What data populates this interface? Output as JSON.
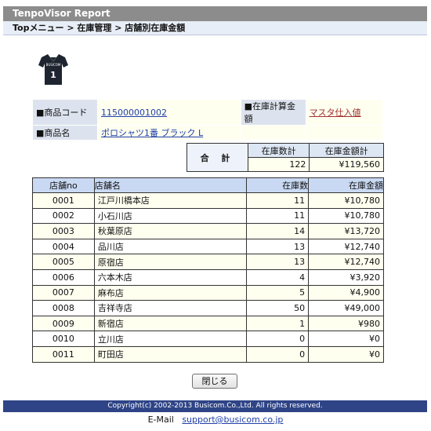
{
  "header": {
    "title": "TenpoVisor Report"
  },
  "breadcrumb": {
    "items": [
      "Topメニュー",
      "在庫管理",
      "店舗別在庫金額"
    ],
    "separator": ">"
  },
  "product_image": {
    "brand": "BUSICOM",
    "number": "1",
    "color": "#1e2530"
  },
  "info": {
    "code_label": "■商品コード",
    "code_value": "115000001002",
    "calc_label": "■在庫計算金額",
    "calc_value": "マスタ仕入値",
    "name_label": "■商品名",
    "name_value": "ポロシャツ1番 ブラック L"
  },
  "summary": {
    "total_label": "合 計",
    "qty_header": "在庫数計",
    "amount_header": "在庫金額計",
    "qty_total": "122",
    "amount_total": "¥119,560"
  },
  "table": {
    "headers": [
      "店舗no",
      "店舗名",
      "在庫数",
      "在庫金額"
    ],
    "rows": [
      [
        "0001",
        "江戸川橋本店",
        "11",
        "¥10,780"
      ],
      [
        "0002",
        "小石川店",
        "11",
        "¥10,780"
      ],
      [
        "0003",
        "秋葉原店",
        "14",
        "¥13,720"
      ],
      [
        "0004",
        "品川店",
        "13",
        "¥12,740"
      ],
      [
        "0005",
        "原宿店",
        "13",
        "¥12,740"
      ],
      [
        "0006",
        "六本木店",
        "4",
        "¥3,920"
      ],
      [
        "0007",
        "麻布店",
        "5",
        "¥4,900"
      ],
      [
        "0008",
        "吉祥寺店",
        "50",
        "¥49,000"
      ],
      [
        "0009",
        "新宿店",
        "1",
        "¥980"
      ],
      [
        "0010",
        "立川店",
        "0",
        "¥0"
      ],
      [
        "0011",
        "町田店",
        "0",
        "¥0"
      ]
    ]
  },
  "close_button": {
    "label": "閉じる"
  },
  "footer": {
    "copyright": "Copyright(c) 2002-2013 Busicom.Co.,Ltd. All rights reserved.",
    "email_label": "E-Mail",
    "email_value": "support@busicom.co.jp"
  },
  "colors": {
    "title_bar": "#8c8c8c",
    "breadcrumb_bg": "#e8eef7",
    "table_header": "#c9d9f3",
    "row_odd": "#fffff0",
    "footer_bg": "#2f4487"
  }
}
